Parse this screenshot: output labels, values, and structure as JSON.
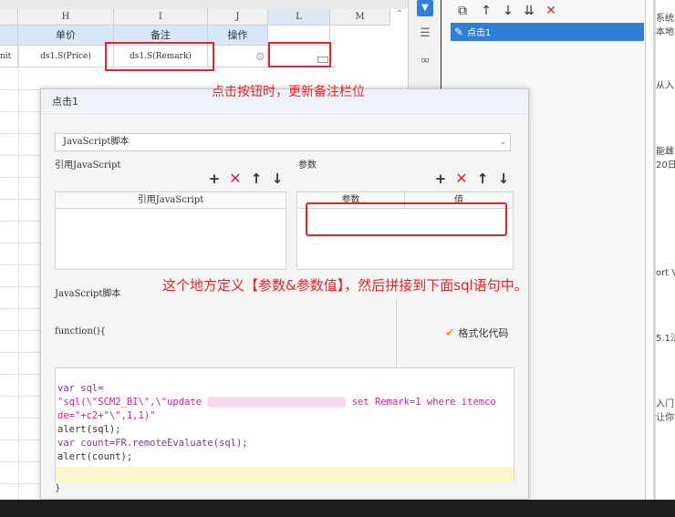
{
  "sheet": {
    "columns": [
      "H",
      "I",
      "J",
      "L",
      "M"
    ],
    "header_row": [
      "单价",
      "备注",
      "操作"
    ],
    "data_row": {
      "unit_partial": "nit",
      "price": "ds1.S(Price)",
      "remark": "ds1.S(Remark)"
    }
  },
  "event_panel": {
    "event_name": "点击1"
  },
  "right_strip": [
    "系统",
    "本地",
    "从入",
    "能雌",
    "20日",
    "ort V",
    "5.1法",
    "入门",
    "让你"
  ],
  "dialog": {
    "title": "点击1",
    "type_select": "JavaScript脚本",
    "ref_js_label": "引用JavaScript",
    "ref_js_col": "引用JavaScript",
    "params_label": "参数",
    "params_cols": [
      "参数",
      "值"
    ],
    "script_label": "JavaScript脚本",
    "function_line": "function(){",
    "format_button": "格式化代码",
    "code": {
      "l1": "var sql=",
      "l2a": "\"sql(\\\"SCM2_BI\\\",\\\"update ",
      "l2b": " set Remark=1 where itemco",
      "l3": "de=\"+c2+\"\\\",1,1)\"",
      "l4": "alert(sql);",
      "l5": "var count=FR.remoteEvaluate(sql);",
      "l6": "alert(count);"
    },
    "close_brace": "}"
  },
  "annotations": {
    "top": "点击按钮时，更新备注栏位",
    "middle": "这个地方定义【参数&参数值】，然后拼接到下面sql语句中。"
  },
  "colors": {
    "highlight_red": "#e0262a",
    "selection_blue": "#2f7fd6"
  }
}
